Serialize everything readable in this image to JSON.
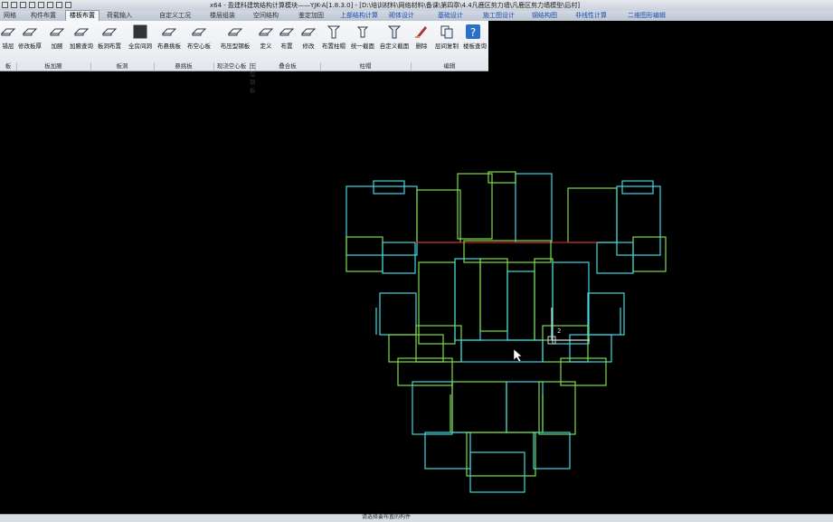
{
  "titlebar": {
    "title": "x64 - 盈建科建筑结构计算模块——YJK-A[1.8.3.0] - [D:\\培训材料\\网络材料\\备课\\第四章\\4.4凡鹿区剪力墙\\凡鹿区剪力墙模型\\后村]"
  },
  "tabs": [
    {
      "label": "网格",
      "active": false,
      "blue": false
    },
    {
      "label": "构件布置",
      "active": false,
      "blue": false
    },
    {
      "label": "楼板布置",
      "active": true,
      "blue": false
    },
    {
      "label": "荷载输入",
      "active": false,
      "blue": false
    },
    {
      "label": "自定义工况",
      "active": false,
      "blue": false
    },
    {
      "label": "楼层组装",
      "active": false,
      "blue": false
    },
    {
      "label": "空间结构",
      "active": false,
      "blue": false
    },
    {
      "label": "鉴定加固",
      "active": false,
      "blue": false
    },
    {
      "label": "上部结构计算",
      "active": false,
      "blue": true
    },
    {
      "label": "砌体设计",
      "active": false,
      "blue": true
    },
    {
      "label": "基础设计",
      "active": false,
      "blue": true
    },
    {
      "label": "施工图设计",
      "active": false,
      "blue": true
    },
    {
      "label": "钢结构图",
      "active": false,
      "blue": true
    },
    {
      "label": "非线性计算",
      "active": false,
      "blue": true
    },
    {
      "label": "二维图形编辑",
      "active": false,
      "blue": true
    }
  ],
  "ribbon": {
    "buttons": [
      {
        "label": "错层",
        "icon": "stair-slab-icon"
      },
      {
        "label": "修改板厚",
        "icon": "edit-thickness-icon"
      },
      {
        "label": "加腋",
        "icon": "haunch-icon"
      },
      {
        "label": "加腋查询",
        "icon": "haunch-query-icon"
      },
      {
        "label": "板洞布置",
        "icon": "slab-hole-icon"
      },
      {
        "label": "全房间洞",
        "icon": "room-hole-icon"
      },
      {
        "label": "布悬挑板",
        "icon": "cantilever-slab-icon"
      },
      {
        "label": "布空心板",
        "icon": "hollow-slab-icon"
      },
      {
        "label": "布压型钢板",
        "icon": "profiled-deck-icon"
      },
      {
        "label": "定义",
        "icon": "define-icon"
      },
      {
        "label": "布置",
        "icon": "place-icon"
      },
      {
        "label": "修改",
        "icon": "modify-icon"
      },
      {
        "label": "布置柱帽",
        "icon": "column-cap-icon"
      },
      {
        "label": "统一截面",
        "icon": "uniform-section-icon"
      },
      {
        "label": "自定义截面",
        "icon": "custom-section-icon"
      },
      {
        "label": "删除",
        "icon": "delete-icon"
      },
      {
        "label": "层间复制",
        "icon": "copy-floor-icon"
      },
      {
        "label": "楼板查询",
        "icon": "query-icon"
      }
    ],
    "groups": [
      {
        "label": "板"
      },
      {
        "label": "板加腋"
      },
      {
        "label": "板洞"
      },
      {
        "label": "悬挑板"
      },
      {
        "label": "现浇空心板"
      },
      {
        "label": "压型钢板"
      },
      {
        "label": "叠合板"
      },
      {
        "label": "柱帽"
      },
      {
        "label": "编辑"
      }
    ]
  },
  "colors": {
    "canvas_bg": "#000000",
    "wall_green": "#7fdc4a",
    "wall_cyan": "#3fd8e0",
    "axis_red": "#c02020",
    "label_white": "#d8d8d8"
  },
  "canvas": {
    "label_2": "2"
  },
  "status": {
    "command_text": "请选择要布置的构件"
  }
}
